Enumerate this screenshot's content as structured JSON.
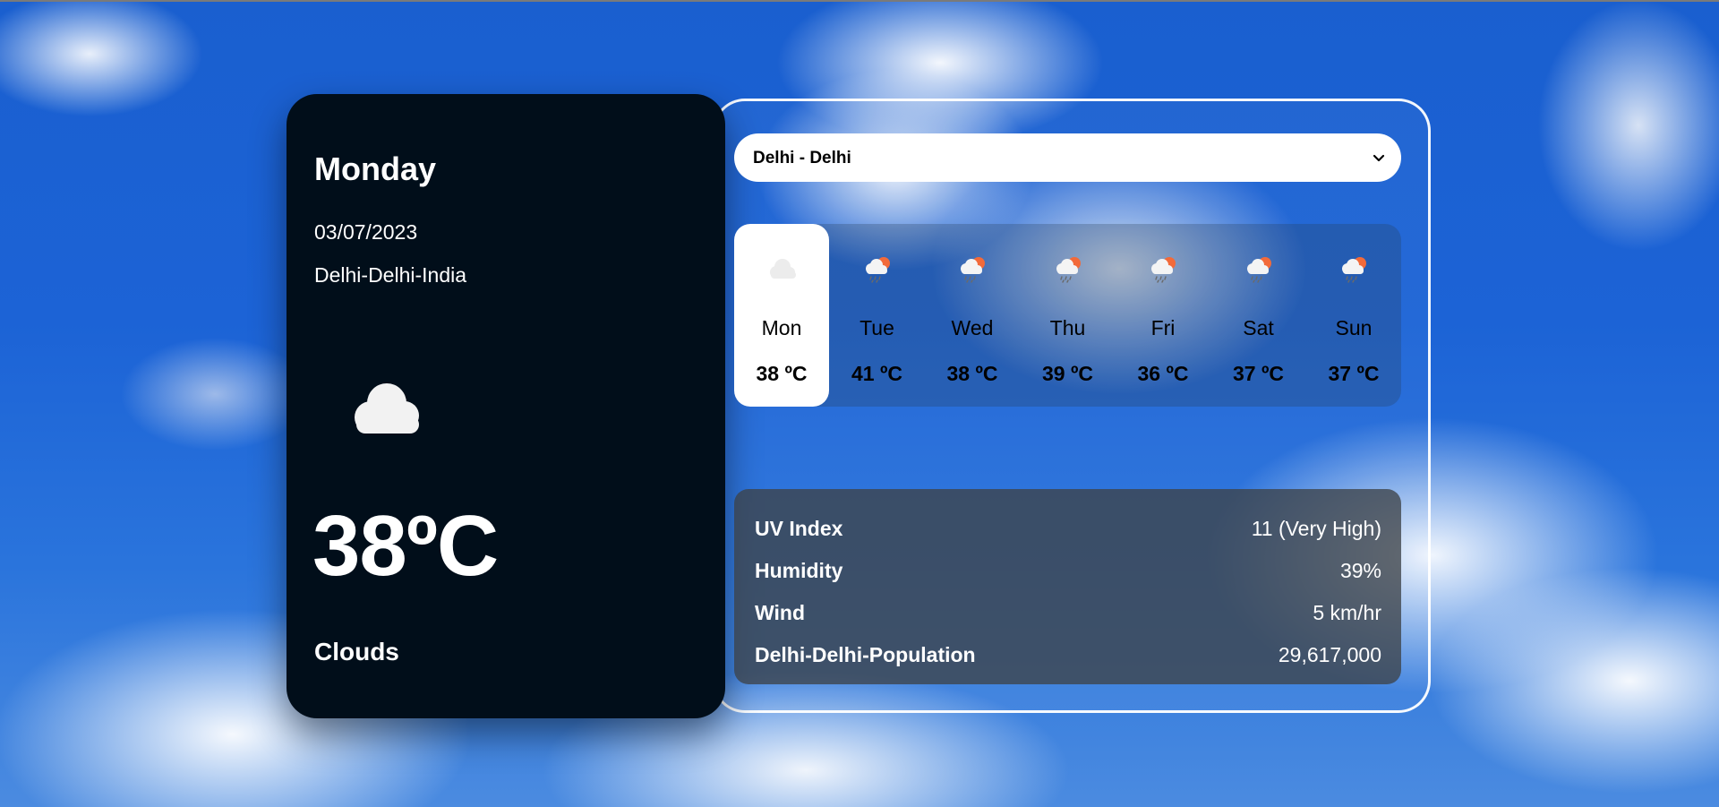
{
  "current": {
    "day": "Monday",
    "date": "03/07/2023",
    "location": "Delhi-Delhi-India",
    "icon": "cloud-icon",
    "temperature": "38ºC",
    "condition": "Clouds"
  },
  "city_select": {
    "selected": "Delhi - Delhi",
    "options": [
      "Delhi - Delhi"
    ]
  },
  "week": [
    {
      "day": "Mon",
      "temp": "38 ºC",
      "icon": "cloud-icon",
      "active": true
    },
    {
      "day": "Tue",
      "temp": "41 ºC",
      "icon": "sun-rain-cloud-icon",
      "active": false
    },
    {
      "day": "Wed",
      "temp": "38 ºC",
      "icon": "sun-rain-cloud-icon",
      "active": false
    },
    {
      "day": "Thu",
      "temp": "39 ºC",
      "icon": "sun-rain-cloud-icon",
      "active": false
    },
    {
      "day": "Fri",
      "temp": "36 ºC",
      "icon": "sun-rain-cloud-icon",
      "active": false
    },
    {
      "day": "Sat",
      "temp": "37 ºC",
      "icon": "sun-rain-cloud-icon",
      "active": false
    },
    {
      "day": "Sun",
      "temp": "37 ºC",
      "icon": "sun-rain-cloud-icon",
      "active": false
    }
  ],
  "stats": [
    {
      "label": "UV Index",
      "value": "11 (Very High)"
    },
    {
      "label": "Humidity",
      "value": "39%"
    },
    {
      "label": "Wind",
      "value": "5 km/hr"
    },
    {
      "label": "Delhi-Delhi-Population",
      "value": "29,617,000"
    }
  ],
  "colors": {
    "card_bg": "#010e1a",
    "sky": "#1c63d6",
    "sun_accent": "#f26a3a"
  }
}
